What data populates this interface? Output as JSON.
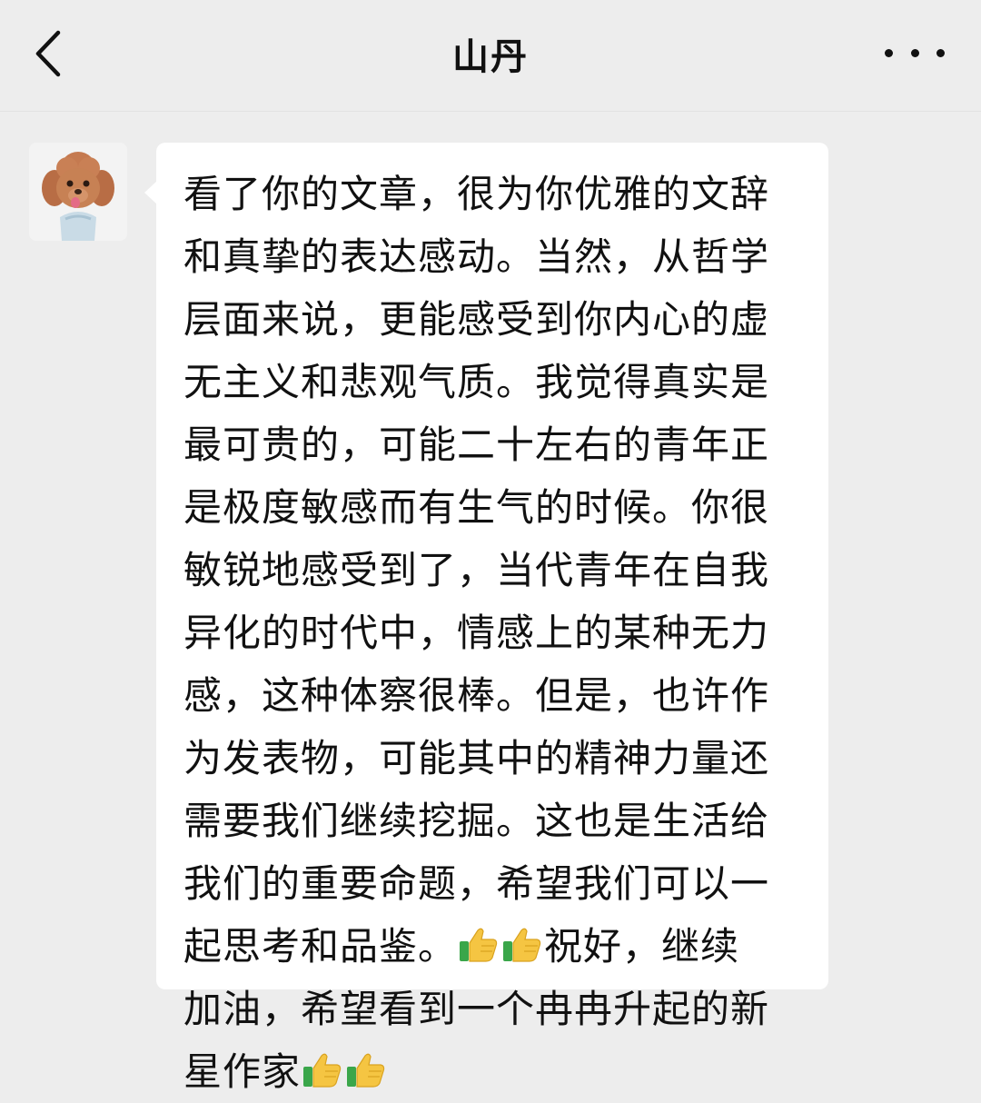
{
  "header": {
    "title": "山丹",
    "back_icon": "chevron-left-icon",
    "more_icon": "more-horizontal-icon"
  },
  "message": {
    "sender_avatar": "poodle-avatar",
    "lines": [
      "看了你的文章，很为你优雅的文辞",
      "和真挚的表达感动。当然，从哲学",
      "层面来说，更能感受到你内心的虚",
      "无主义和悲观气质。我觉得真实是",
      "最可贵的，可能二十左右的青年正",
      "是极度敏感而有生气的时候。你很",
      "敏锐地感受到了，当代青年在自我",
      "异化的时代中，情感上的某种无力",
      "感，这种体察很棒。但是，也许作",
      "为发表物，可能其中的精神力量还",
      "需要我们继续挖掘。这也是生活给",
      "我们的重要命题，希望我们可以一"
    ],
    "line13_before": "起思考和品鉴。",
    "line13_after": "祝好，继续",
    "line14": "加油，希望看到一个冉冉升起的新",
    "line15_before": "星作家",
    "emoji": "thumbs-up-icon"
  }
}
